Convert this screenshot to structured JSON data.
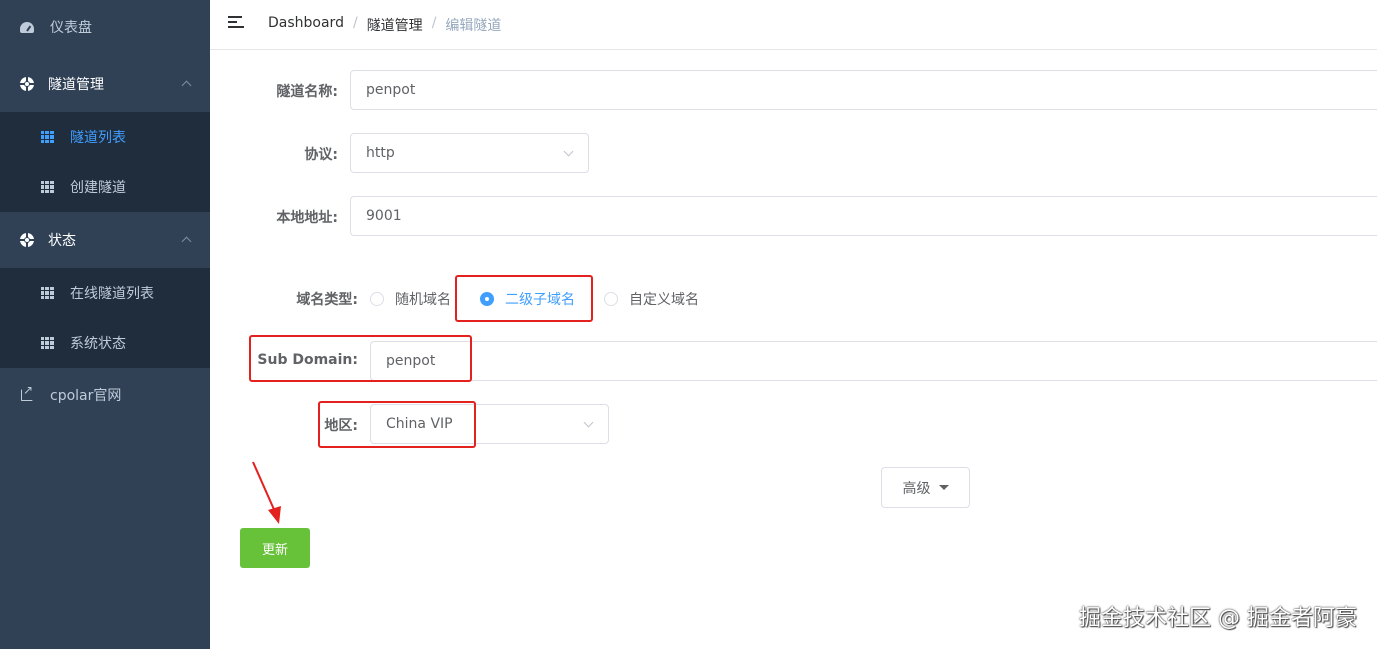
{
  "sidebar": {
    "dashboard": {
      "label": "仪表盘",
      "icon": "dashboard-icon"
    },
    "tunnel_mgmt": {
      "label": "隧道管理",
      "icon": "lifebuoy-icon",
      "items": [
        {
          "label": "隧道列表",
          "icon": "grid-icon",
          "active": true
        },
        {
          "label": "创建隧道",
          "icon": "grid-icon",
          "active": false
        }
      ]
    },
    "status": {
      "label": "状态",
      "icon": "lifebuoy-icon",
      "items": [
        {
          "label": "在线隧道列表",
          "icon": "grid-icon"
        },
        {
          "label": "系统状态",
          "icon": "grid-icon"
        }
      ]
    },
    "cpolar_site": {
      "label": "cpolar官网",
      "icon": "external-link-icon"
    }
  },
  "header": {
    "breadcrumb": [
      "Dashboard",
      "隧道管理",
      "编辑隧道"
    ]
  },
  "form": {
    "tunnel_name": {
      "label": "隧道名称:",
      "value": "penpot"
    },
    "protocol": {
      "label": "协议:",
      "value": "http"
    },
    "local_address": {
      "label": "本地地址:",
      "value": "9001"
    },
    "domain_type": {
      "label": "域名类型:",
      "options": [
        "随机域名",
        "二级子域名",
        "自定义域名"
      ],
      "selected": "二级子域名"
    },
    "sub_domain": {
      "label": "Sub Domain:",
      "value": "penpot"
    },
    "region": {
      "label": "地区:",
      "value": "China VIP"
    },
    "advanced_label": "高级",
    "update_label": "更新"
  },
  "colors": {
    "sidebar_bg": "#304156",
    "submenu_bg": "#1f2d3d",
    "accent": "#409eff",
    "update_button": "#67c23a",
    "highlight_box": "#e3211f"
  },
  "watermark": "掘金技术社区 @ 掘金者阿豪"
}
